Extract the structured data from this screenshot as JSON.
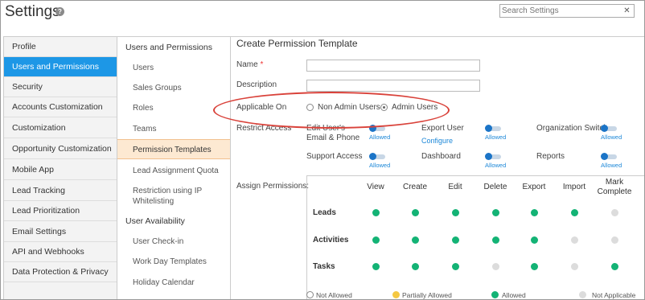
{
  "header": {
    "title": "Settings",
    "help_glyph": "?",
    "search_placeholder": "Search Settings",
    "search_clear_glyph": "✕"
  },
  "left_nav": {
    "items": [
      {
        "label": "Profile",
        "active": false
      },
      {
        "label": "Users and Permissions",
        "active": true
      },
      {
        "label": "Security",
        "active": false
      },
      {
        "label": "Accounts Customization",
        "active": false
      },
      {
        "label": "Customization",
        "active": false
      },
      {
        "label": "Opportunity Customization",
        "active": false
      },
      {
        "label": "Mobile App",
        "active": false
      },
      {
        "label": "Lead Tracking",
        "active": false
      },
      {
        "label": "Lead Prioritization",
        "active": false
      },
      {
        "label": "Email Settings",
        "active": false
      },
      {
        "label": "API and Webhooks",
        "active": false
      },
      {
        "label": "Data Protection & Privacy",
        "active": false
      }
    ]
  },
  "mid_nav": {
    "heading_users": "Users and Permissions",
    "items_users": [
      {
        "label": "Users",
        "active": false
      },
      {
        "label": "Sales Groups",
        "active": false
      },
      {
        "label": "Roles",
        "active": false
      },
      {
        "label": "Teams",
        "active": false
      },
      {
        "label": "Permission Templates",
        "active": true
      },
      {
        "label": "Lead Assignment Quota",
        "active": false
      },
      {
        "label": "Restriction using IP Whitelisting",
        "active": false
      }
    ],
    "heading_availability": "User Availability",
    "items_availability": [
      {
        "label": "User Check-in"
      },
      {
        "label": "Work Day Templates"
      },
      {
        "label": "Holiday Calendar"
      }
    ]
  },
  "form": {
    "title": "Create Permission Template",
    "name_label": "Name",
    "required_mark": "*",
    "name_value": "",
    "description_label": "Description",
    "description_value": "",
    "applicable_on_label": "Applicable On",
    "applicable_options": [
      {
        "label": "Non Admin Users",
        "checked": false
      },
      {
        "label": "Admin Users",
        "checked": true
      }
    ],
    "restrict_access_label": "Restrict Access",
    "restrictions": [
      {
        "label": "Edit User's Email & Phone",
        "state": "Allowed"
      },
      {
        "label": "Export User",
        "state": "Allowed",
        "link": "Configure"
      },
      {
        "label": "Organization Switch",
        "state": "Allowed"
      },
      {
        "label": "Support Access",
        "state": "Allowed"
      },
      {
        "label": "Dashboard",
        "state": "Allowed"
      },
      {
        "label": "Reports",
        "state": "Allowed"
      }
    ],
    "assign_permissions_label": "Assign Permissions:"
  },
  "permissions_grid": {
    "columns": [
      "View",
      "Create",
      "Edit",
      "Delete",
      "Export",
      "Import",
      "Mark Complete"
    ],
    "rows": [
      {
        "name": "Leads",
        "values": [
          "allowed",
          "allowed",
          "allowed",
          "allowed",
          "allowed",
          "allowed",
          "not_applicable"
        ]
      },
      {
        "name": "Activities",
        "values": [
          "allowed",
          "allowed",
          "allowed",
          "allowed",
          "allowed",
          "not_applicable",
          "not_applicable"
        ]
      },
      {
        "name": "Tasks",
        "values": [
          "allowed",
          "allowed",
          "allowed",
          "not_applicable",
          "allowed",
          "not_applicable",
          "allowed"
        ]
      }
    ]
  },
  "legend": [
    {
      "label": "Not Allowed",
      "color": "#ffffff"
    },
    {
      "label": "Partially Allowed",
      "color": "#f5c842"
    },
    {
      "label": "Allowed",
      "color": "#13b375"
    },
    {
      "label": "Not Applicable",
      "color": "#dcdcdc"
    }
  ],
  "colors": {
    "accent": "#1d97e6",
    "allowed": "#13b375",
    "not_applicable": "#dcdcdc",
    "highlight": "#d9423a"
  }
}
